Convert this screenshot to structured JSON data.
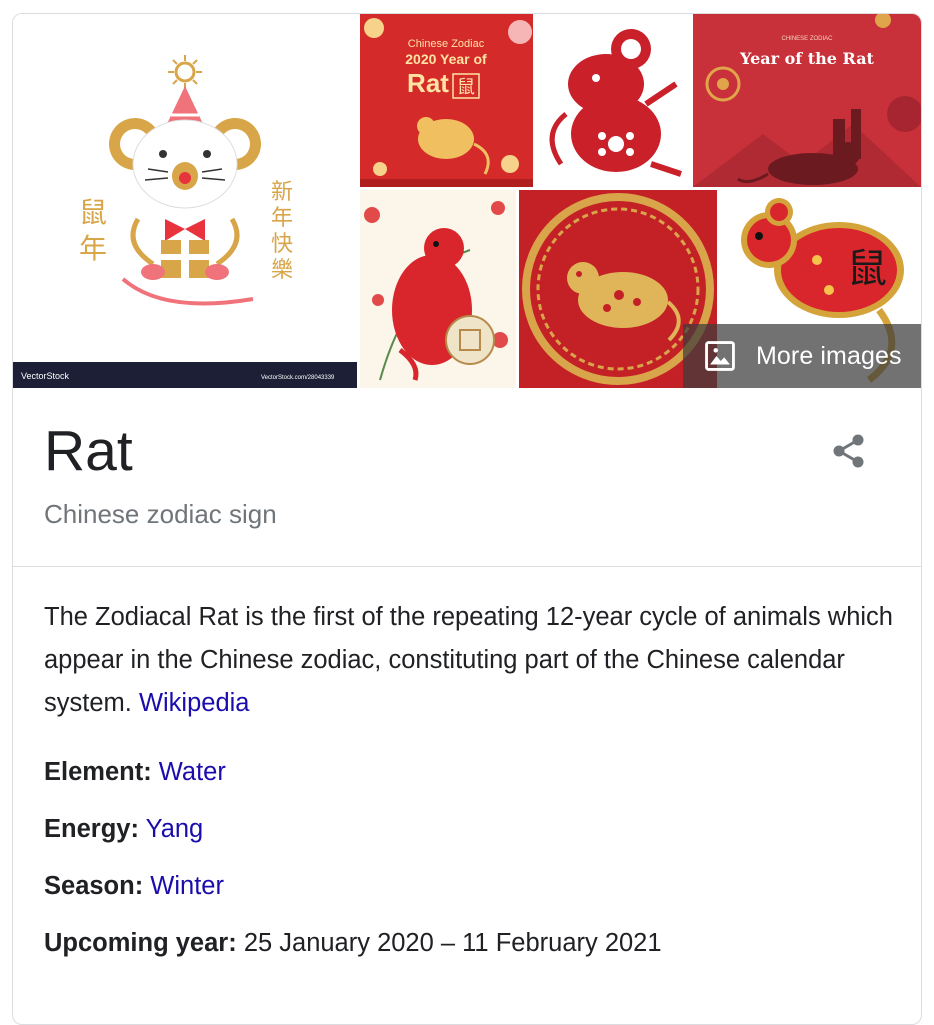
{
  "gallery": {
    "more_images_label": "More images",
    "main_image": {
      "left_chars": "鼠年",
      "right_chars": "新年快樂",
      "watermark_left": "VectorStock",
      "watermark_right": "VectorStock.com/28043339"
    },
    "tile2": {
      "line1": "Chinese Zodiac",
      "line2": "2020 Year of",
      "line3": "Rat",
      "char": "鼠"
    },
    "tile4": {
      "top": "CHINESE ZODIAC",
      "title": "Year of the Rat"
    },
    "tile7": {
      "char": "鼠"
    }
  },
  "entity": {
    "title": "Rat",
    "subtitle": "Chinese zodiac sign"
  },
  "description": {
    "text": "The Zodiacal Rat is the first of the repeating 12-year cycle of animals which appear in the Chinese zodiac, constituting part of the Chinese calendar system. ",
    "source_link": "Wikipedia"
  },
  "facts": [
    {
      "label": "Element:",
      "value": "Water",
      "link": true
    },
    {
      "label": "Energy:",
      "value": "Yang",
      "link": true
    },
    {
      "label": "Season:",
      "value": "Winter",
      "link": true
    },
    {
      "label": "Upcoming year:",
      "value": "25 January 2020 – 11 February 2021",
      "link": false
    }
  ],
  "colors": {
    "red": "#d8262c",
    "gold": "#d4a43a",
    "link": "#1a0dab",
    "subtitle_gray": "#70757a"
  },
  "icons": [
    "image-icon",
    "share-icon"
  ]
}
